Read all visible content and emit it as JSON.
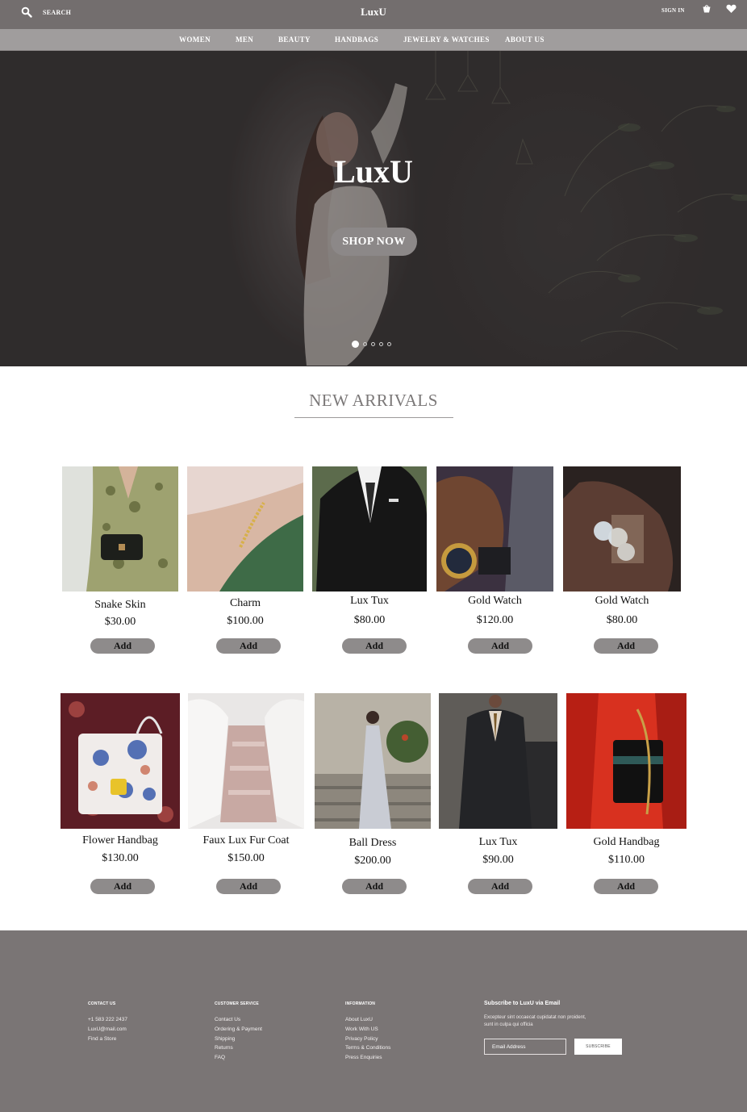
{
  "header": {
    "search_label": "SEARCH",
    "logo": "LuxU",
    "signin_label": "SIGN IN",
    "icons": [
      "search-icon",
      "cart-icon",
      "heart-icon"
    ]
  },
  "nav": {
    "items": [
      "WOMEN",
      "MEN",
      "BEAUTY",
      "HANDBAGS",
      "JEWELRY & WATCHES",
      "ABOUT US"
    ]
  },
  "hero": {
    "title": "LuxU",
    "cta": "SHOP NOW",
    "slide_count": 5,
    "active_slide": 1
  },
  "arrivals": {
    "title": "NEW ARRIVALS",
    "add_label": "Add",
    "products": [
      {
        "name": "Snake Skin",
        "price": "$30.00"
      },
      {
        "name": "Charm",
        "price": "$100.00"
      },
      {
        "name": "Lux Tux",
        "price": "$80.00"
      },
      {
        "name": "Gold Watch",
        "price": "$120.00"
      },
      {
        "name": "Gold Watch",
        "price": "$80.00"
      },
      {
        "name": "Flower Handbag",
        "price": "$130.00"
      },
      {
        "name": "Faux Lux Fur Coat",
        "price": "$150.00"
      },
      {
        "name": "Ball Dress",
        "price": "$200.00"
      },
      {
        "name": "Lux Tux",
        "price": "$90.00"
      },
      {
        "name": "Gold Handbag",
        "price": "$110.00"
      }
    ]
  },
  "footer": {
    "contact": {
      "title": "CONTACT US",
      "links": [
        "+1 583 222 2437",
        "LuxU@mail.com",
        "Find a Store"
      ]
    },
    "service": {
      "title": "CUSTOMER SERVICE",
      "links": [
        "Contact Us",
        "Ordering & Payment",
        "Shipping",
        "Returns",
        "FAQ"
      ]
    },
    "information": {
      "title": "INFORMATION",
      "links": [
        "About LuxU",
        "Work With US",
        "Privacy Policy",
        "Terms & Conditions",
        "Press Enquiries"
      ]
    },
    "subscribe": {
      "title": "Subscribe to LuxU via Email",
      "text": "Excepteur sint occaecat cupidatat non proident, sunt in culpa qui officia",
      "email_placeholder": "Email Address",
      "button": "SUBSCRIBE"
    }
  },
  "colors": {
    "topbar": "#736e6e",
    "nav": "#a09d9d",
    "button": "#8e8b8b",
    "footer": "#7a7575",
    "heading": "#7b7878"
  }
}
